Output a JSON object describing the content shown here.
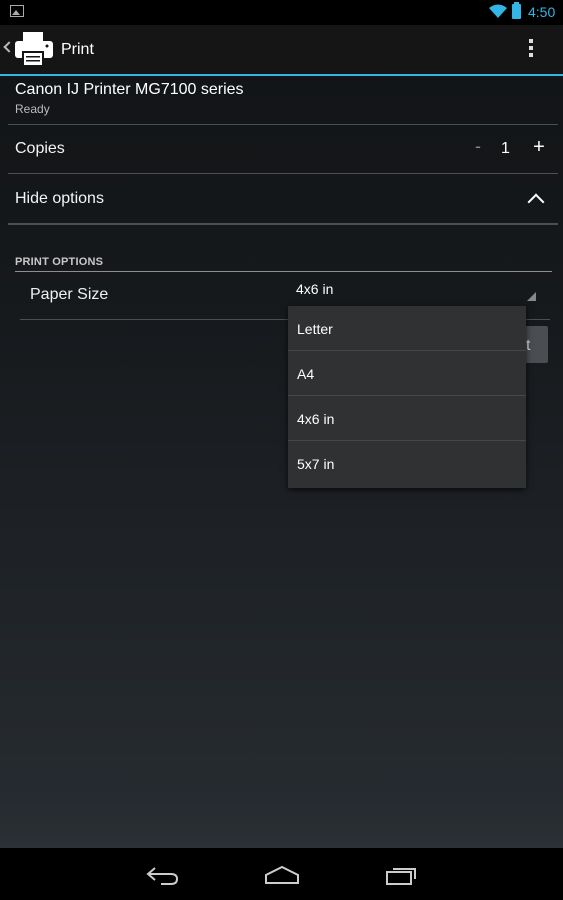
{
  "status_bar": {
    "time": "4:50"
  },
  "action_bar": {
    "title": "Print"
  },
  "printer": {
    "name": "Canon IJ Printer MG7100 series",
    "status": "Ready"
  },
  "copies": {
    "label": "Copies",
    "minus": "-",
    "value": "1",
    "plus": "+"
  },
  "options_toggle": {
    "label": "Hide options"
  },
  "print_options": {
    "header": "PRINT OPTIONS",
    "paper_size_label": "Paper Size",
    "paper_size_value": "4x6 in"
  },
  "partially_hidden_button": {
    "label": "t"
  },
  "dropdown": {
    "options": [
      "Letter",
      "A4",
      "4x6 in",
      "5x7 in"
    ]
  },
  "colors": {
    "accent": "#33b5e5"
  }
}
